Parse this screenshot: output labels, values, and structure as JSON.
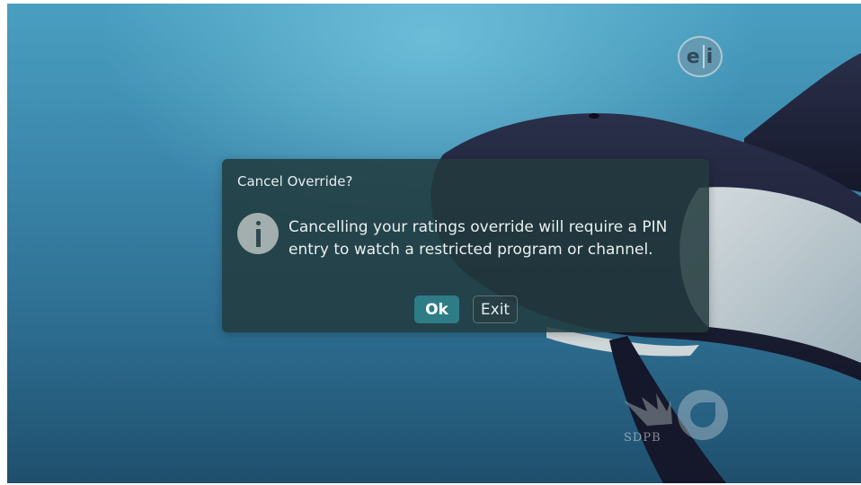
{
  "channel_badge": {
    "left": "e",
    "right": "i"
  },
  "watermark": {
    "text": "SDPB"
  },
  "dialog": {
    "title": "Cancel Override?",
    "icon": "info-icon",
    "message_line1": "Cancelling your ratings override will require a PIN",
    "message_line2": "entry to watch a restricted program or channel.",
    "ok_label": "Ok",
    "exit_label": "Exit",
    "focused_button": "Ok"
  },
  "colors": {
    "dialog_background": "#223a3e",
    "ok_button": "#2e7c86",
    "info_icon": "#a3aeae"
  }
}
